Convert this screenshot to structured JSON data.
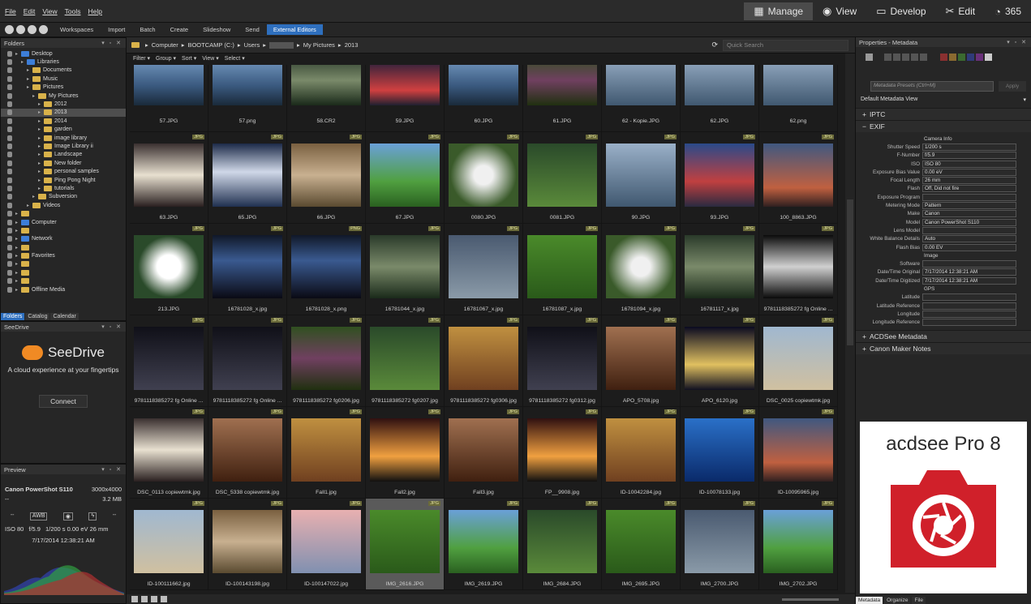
{
  "menu": [
    "File",
    "Edit",
    "View",
    "Tools",
    "Help"
  ],
  "modes": [
    {
      "label": "Manage",
      "active": true
    },
    {
      "label": "View"
    },
    {
      "label": "Develop"
    },
    {
      "label": "Edit"
    },
    {
      "label": "365"
    }
  ],
  "toolbar": [
    "Workspaces",
    "Import",
    "Batch",
    "Create",
    "Slideshow",
    "Send",
    "External Editors"
  ],
  "folders": {
    "title": "Folders",
    "nodes": [
      {
        "label": "Desktop",
        "depth": 0,
        "icon": "blue"
      },
      {
        "label": "Libraries",
        "depth": 1,
        "icon": "blue"
      },
      {
        "label": "Documents",
        "depth": 2
      },
      {
        "label": "Music",
        "depth": 2
      },
      {
        "label": "Pictures",
        "depth": 2
      },
      {
        "label": "My Pictures",
        "depth": 3
      },
      {
        "label": "2012",
        "depth": 4
      },
      {
        "label": "2013",
        "depth": 4,
        "selected": true
      },
      {
        "label": "2014",
        "depth": 4
      },
      {
        "label": "garden",
        "depth": 4
      },
      {
        "label": "image library",
        "depth": 4
      },
      {
        "label": "Image Library ii",
        "depth": 4
      },
      {
        "label": "Landscape",
        "depth": 4
      },
      {
        "label": "New folder",
        "depth": 4
      },
      {
        "label": "personal samples",
        "depth": 4
      },
      {
        "label": "Ping Pong Night",
        "depth": 4
      },
      {
        "label": "tutorials",
        "depth": 4
      },
      {
        "label": "Subversion",
        "depth": 3
      },
      {
        "label": "Videos",
        "depth": 2
      },
      {
        "label": "",
        "depth": 0
      },
      {
        "label": "Computer",
        "depth": 0,
        "icon": "blue"
      },
      {
        "label": "",
        "depth": 0
      },
      {
        "label": "Network",
        "depth": 0,
        "icon": "blue"
      },
      {
        "label": "",
        "depth": 0
      },
      {
        "label": "Favorites",
        "depth": 0
      },
      {
        "label": "",
        "depth": 0
      },
      {
        "label": "",
        "depth": 0
      },
      {
        "label": "",
        "depth": 0
      },
      {
        "label": "Offline Media",
        "depth": 0
      }
    ],
    "tabs": [
      "Folders",
      "Catalog",
      "Calendar"
    ]
  },
  "seedrive": {
    "title": "SeeDrive",
    "brand": "SeeDrive",
    "tagline": "A cloud experience at your fingertips",
    "connect": "Connect"
  },
  "preview": {
    "title": "Preview",
    "camera": "Canon PowerShot S110",
    "resolution": "3000x4000",
    "dash": "--",
    "size": "3.2 MB",
    "awb": "AWB",
    "iso": "ISO 80",
    "fnum": "f/5.9",
    "exposure": "1/200 s 0.00 eV 26 mm",
    "date": "7/17/2014 12:38:21 AM"
  },
  "crumbs": [
    "Computer",
    "BOOTCAMP (C:)",
    "Users",
    "",
    "My Pictures",
    "2013"
  ],
  "search": "Quick Search",
  "filters": [
    "Filter",
    "Group",
    "Sort",
    "View",
    "Select"
  ],
  "files": [
    {
      "name": "57.JPG",
      "g": "grad-a"
    },
    {
      "name": "57.png",
      "g": "grad-a"
    },
    {
      "name": "58.CR2",
      "g": "grad-m"
    },
    {
      "name": "59.JPG",
      "g": "grad-h"
    },
    {
      "name": "60.JPG",
      "g": "grad-a"
    },
    {
      "name": "61.JPG",
      "g": "grad-s"
    },
    {
      "name": "62 - Kopie.JPG",
      "g": "grad-g"
    },
    {
      "name": "62.JPG",
      "g": "grad-g"
    },
    {
      "name": "62.png",
      "g": "grad-g"
    },
    {
      "name": "63.JPG",
      "g": "grad-j",
      "b": "JPG"
    },
    {
      "name": "65.JPG",
      "g": "grad-b",
      "b": "JPG"
    },
    {
      "name": "66.JPG",
      "g": "grad-c",
      "b": "JPG"
    },
    {
      "name": "67.JPG",
      "g": "grad-d",
      "b": "JPG"
    },
    {
      "name": "0080.JPG",
      "g": "grad-e",
      "b": "JPG"
    },
    {
      "name": "0081.JPG",
      "g": "grad-f",
      "b": "JPG"
    },
    {
      "name": "90.JPG",
      "g": "grad-g",
      "b": "JPG"
    },
    {
      "name": "93.JPG",
      "g": "grad-i",
      "b": "JPG"
    },
    {
      "name": "100_8863.JPG",
      "g": "grad-x",
      "b": "JPG"
    },
    {
      "name": "213.JPG",
      "g": "grad-o",
      "b": "JPG"
    },
    {
      "name": "16781028_x.jpg",
      "g": "grad-k",
      "b": "JPG"
    },
    {
      "name": "16781028_x.png",
      "g": "grad-k",
      "b": "PNG"
    },
    {
      "name": "16781044_x.jpg",
      "g": "grad-m",
      "b": "JPG"
    },
    {
      "name": "16781067_x.jpg",
      "g": "grad-n",
      "b": "JPG"
    },
    {
      "name": "16781087_x.jpg",
      "g": "grad-aa",
      "b": "JPG"
    },
    {
      "name": "16781094_x.jpg",
      "g": "grad-e",
      "b": "JPG"
    },
    {
      "name": "16781117_x.jpg",
      "g": "grad-m",
      "b": "JPG"
    },
    {
      "name": "9781118385272 fg Online ...",
      "g": "grad-q",
      "b": "JPG"
    },
    {
      "name": "9781118385272 fg Online ...",
      "g": "grad-p",
      "b": "JPG"
    },
    {
      "name": "9781118385272 fg Online ...",
      "g": "grad-p",
      "b": "JPG"
    },
    {
      "name": "9781118385272 fg0206.jpg",
      "g": "grad-s",
      "b": "JPG"
    },
    {
      "name": "9781118385272 fg0207.jpg",
      "g": "grad-f",
      "b": "JPG"
    },
    {
      "name": "9781118385272 fg0306.jpg",
      "g": "grad-t",
      "b": "JPG"
    },
    {
      "name": "9781118385272 fg0312.jpg",
      "g": "grad-p",
      "b": "JPG"
    },
    {
      "name": "APO_5708.jpg",
      "g": "grad-u",
      "b": "JPG"
    },
    {
      "name": "APO_6120.jpg",
      "g": "grad-r",
      "b": "JPG"
    },
    {
      "name": "DSC_0025 copiewtmk.jpg",
      "g": "grad-y",
      "b": "JPG"
    },
    {
      "name": "DSC_0113 copiewtmk.jpg",
      "g": "grad-j",
      "b": "JPG"
    },
    {
      "name": "DSC_5338 copiewtmk.jpg",
      "g": "grad-u",
      "b": "JPG"
    },
    {
      "name": "Fall1.jpg",
      "g": "grad-t",
      "b": "JPG"
    },
    {
      "name": "Fall2.jpg",
      "g": "grad-v",
      "b": "JPG"
    },
    {
      "name": "Fall3.jpg",
      "g": "grad-u",
      "b": "JPG"
    },
    {
      "name": "FP__9908.jpg",
      "g": "grad-v",
      "b": "JPG"
    },
    {
      "name": "ID-10042284.jpg",
      "g": "grad-t",
      "b": "JPG"
    },
    {
      "name": "ID-10078133.jpg",
      "g": "grad-w",
      "b": "JPG"
    },
    {
      "name": "ID-10095965.jpg",
      "g": "grad-x",
      "b": "JPG"
    },
    {
      "name": "ID-100111662.jpg",
      "g": "grad-y",
      "b": "JPG"
    },
    {
      "name": "ID-100143198.jpg",
      "g": "grad-c",
      "b": "JPG"
    },
    {
      "name": "ID-100147022.jpg",
      "g": "grad-z",
      "b": "JPG"
    },
    {
      "name": "IMG_2616.JPG",
      "g": "grad-aa",
      "b": "JPG",
      "sel": true
    },
    {
      "name": "IMG_2619.JPG",
      "g": "grad-d",
      "b": "JPG"
    },
    {
      "name": "IMG_2684.JPG",
      "g": "grad-f",
      "b": "JPG"
    },
    {
      "name": "IMG_2695.JPG",
      "g": "grad-aa",
      "b": "JPG"
    },
    {
      "name": "IMG_2700.JPG",
      "g": "grad-n",
      "b": "JPG"
    },
    {
      "name": "IMG_2702.JPG",
      "g": "grad-d",
      "b": "JPG"
    }
  ],
  "props": {
    "title": "Properties - Metadata",
    "presets": "Metadata Presets (Ctrl+M)",
    "apply": "Apply",
    "view": "Default Metadata View",
    "iptc": "IPTC",
    "exif": "EXIF",
    "fields": [
      {
        "h": "Camera Info"
      },
      {
        "l": "Shutter Speed",
        "v": "1/200 s"
      },
      {
        "l": "F-Number",
        "v": "f/5.9"
      },
      {
        "l": "ISO",
        "v": "ISO 80"
      },
      {
        "l": "Exposure Bias Value",
        "v": "0.00 eV"
      },
      {
        "l": "Focal Length",
        "v": "26 mm"
      },
      {
        "l": "Flash",
        "v": "Off, Did not fire"
      },
      {
        "l": "Exposure Program",
        "v": ""
      },
      {
        "l": "Metering Mode",
        "v": "Pattern"
      },
      {
        "l": "Make",
        "v": "Canon"
      },
      {
        "l": "Model",
        "v": "Canon PowerShot S110"
      },
      {
        "l": "Lens Model",
        "v": ""
      },
      {
        "l": "White Balance Details",
        "v": "Auto"
      },
      {
        "l": "Flash Bias",
        "v": "0.00 EV"
      },
      {
        "h": "Image"
      },
      {
        "l": "Software",
        "v": ""
      },
      {
        "l": "Date/Time Original",
        "v": "7/17/2014 12:38:21 AM"
      },
      {
        "l": "Date/Time Digitized",
        "v": "7/17/2014 12:38:21 AM"
      },
      {
        "h": "GPS"
      },
      {
        "l": "Latitude",
        "v": ""
      },
      {
        "l": "Latitude Reference",
        "v": ""
      },
      {
        "l": "Longitude",
        "v": ""
      },
      {
        "l": "Longitude Reference",
        "v": ""
      }
    ],
    "acdsee": "ACDSee Metadata",
    "canon": "Canon Maker Notes",
    "adtitle": "acdsee Pro 8",
    "tabs": [
      "Metadata",
      "Organize",
      "File"
    ]
  }
}
